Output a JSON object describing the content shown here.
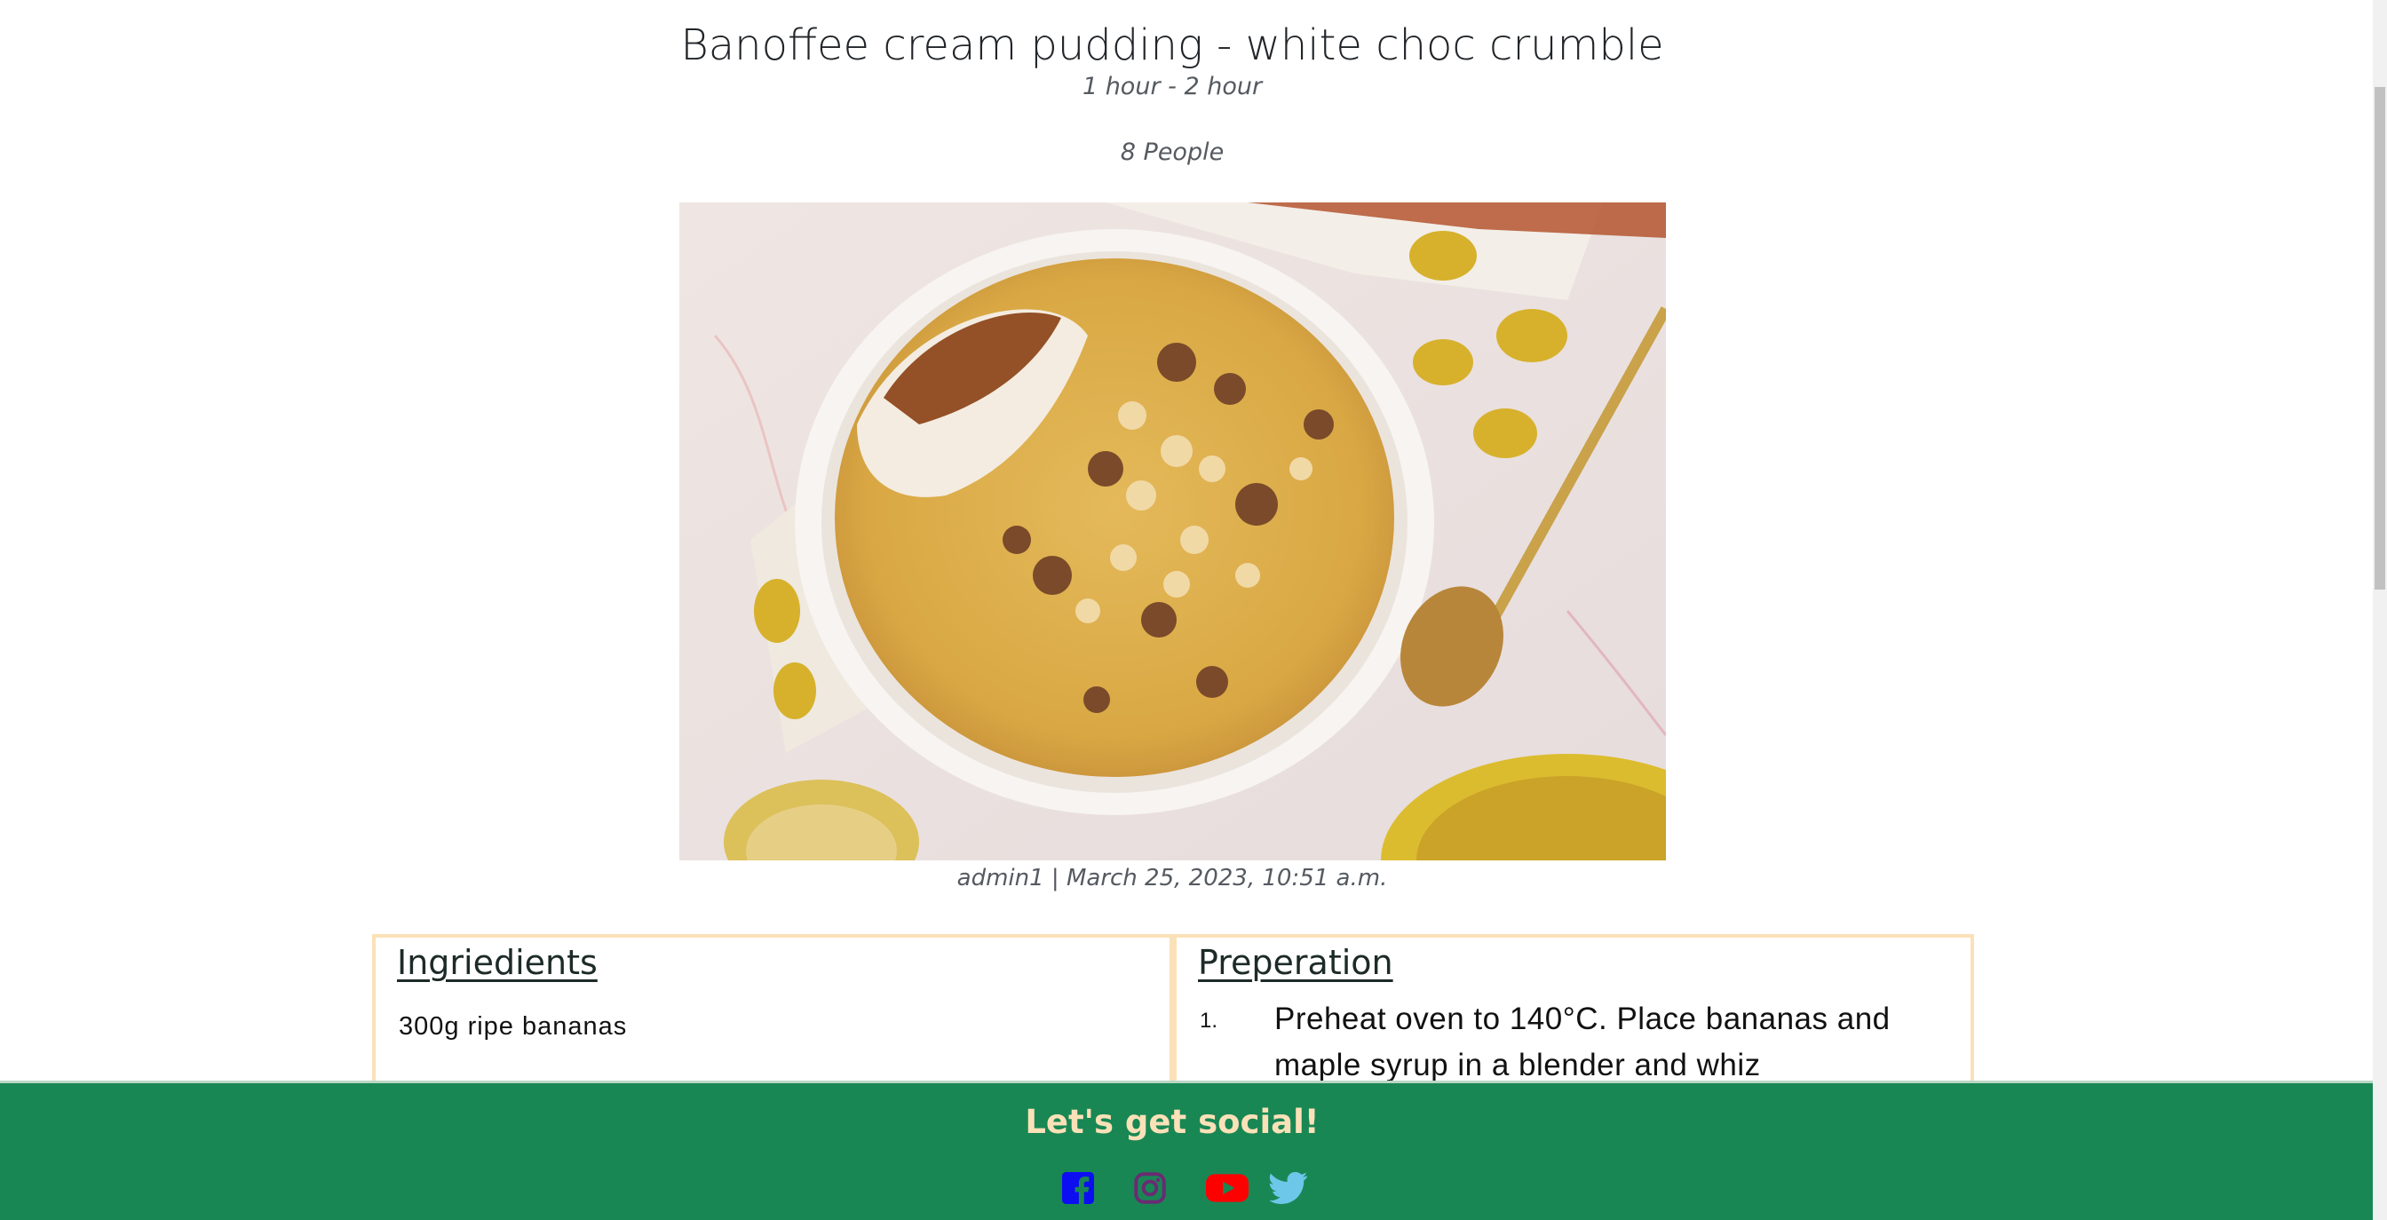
{
  "recipe": {
    "title": "Banoffee cream pudding - white choc crumble",
    "time": "1 hour - 2 hour",
    "serves": "8 People",
    "image_alt": "Banoffee cream pudding in a white dish topped with nuts and crumble",
    "byline": "admin1 | March 25, 2023, 10:51 a.m."
  },
  "ingredients": {
    "heading": "Ingriedients",
    "items": [
      "300g ripe bananas"
    ]
  },
  "preparation": {
    "heading": "Preperation",
    "steps": [
      {
        "number": "1.",
        "text": "Preheat oven to 140°C. Place bananas and maple syrup in a blender and whiz"
      }
    ]
  },
  "footer": {
    "heading": "Let's get social!",
    "social": [
      {
        "name": "facebook",
        "icon": "facebook-icon",
        "color": "#0d0df2"
      },
      {
        "name": "instagram",
        "icon": "instagram-icon",
        "color": "#6a2b73"
      },
      {
        "name": "youtube",
        "icon": "youtube-icon",
        "color": "#ff0000"
      },
      {
        "name": "twitter",
        "icon": "twitter-icon",
        "color": "#6cc7e8"
      }
    ]
  },
  "colors": {
    "footer_bg": "#198754",
    "footer_heading": "#fbe1b8",
    "card_border": "#fbe1b8"
  }
}
